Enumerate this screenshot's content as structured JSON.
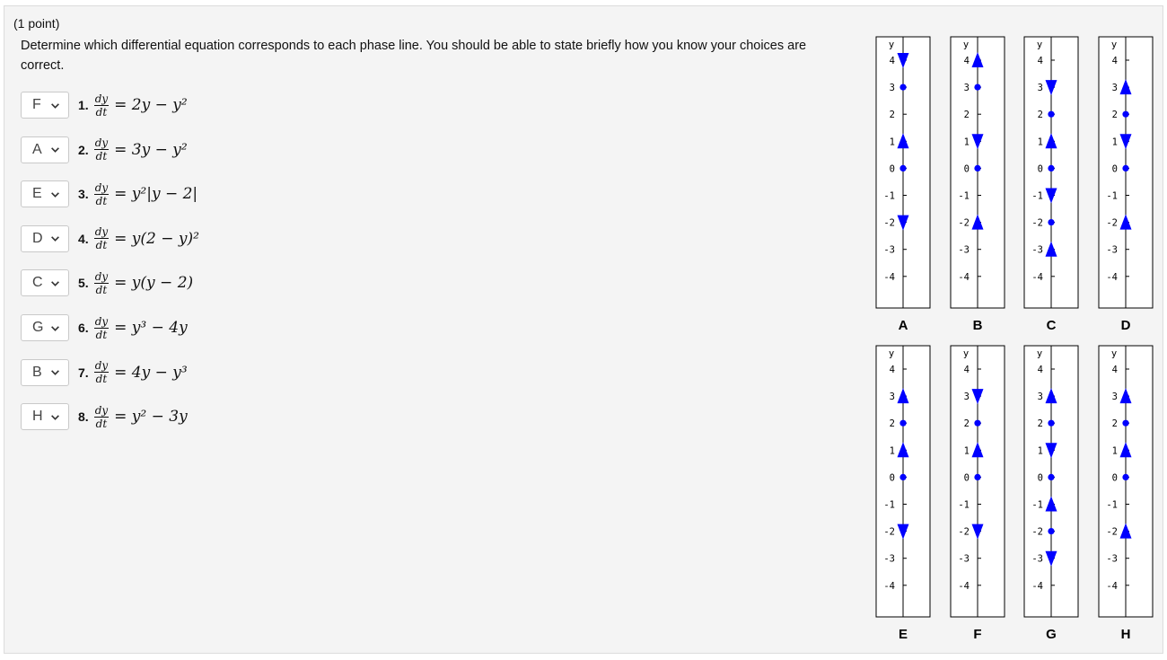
{
  "header": {
    "points": "(1 point)",
    "prompt": "Determine which differential equation corresponds to each phase line. You should be able to state briefly how you know your choices are correct."
  },
  "questions": [
    {
      "selected": "F",
      "number": "1.",
      "rhs": "= 2y − y²"
    },
    {
      "selected": "A",
      "number": "2.",
      "rhs": "= 3y − y²"
    },
    {
      "selected": "E",
      "number": "3.",
      "rhs": "= y²|y − 2|"
    },
    {
      "selected": "D",
      "number": "4.",
      "rhs": "= y(2 − y)²"
    },
    {
      "selected": "C",
      "number": "5.",
      "rhs": "= y(y − 2)"
    },
    {
      "selected": "G",
      "number": "6.",
      "rhs": "= y³ − 4y"
    },
    {
      "selected": "B",
      "number": "7.",
      "rhs": "= 4y − y³"
    },
    {
      "selected": "H",
      "number": "8.",
      "rhs": "= y² − 3y"
    }
  ],
  "derivative": {
    "numerator": "dy",
    "denominator": "dt"
  },
  "colors": {
    "accent": "#0000ff",
    "panel_bg": "#f4f4f4",
    "border": "#c9c9c9"
  },
  "phase_lines": {
    "axis_label": "y",
    "tick_labels": [
      "4",
      "3",
      "2",
      "1",
      "0",
      "-1",
      "-2",
      "-3",
      "-4"
    ],
    "items": [
      {
        "label": "A",
        "dots": [
          3,
          0
        ],
        "up": [
          1
        ],
        "down": [
          4,
          -2
        ]
      },
      {
        "label": "B",
        "dots": [
          3,
          0
        ],
        "up": [
          4,
          -2
        ],
        "down": [
          1
        ]
      },
      {
        "label": "C",
        "dots": [
          2,
          0,
          -2
        ],
        "up": [
          1,
          -3
        ],
        "down": [
          3,
          -1
        ]
      },
      {
        "label": "D",
        "dots": [
          2,
          0
        ],
        "up": [
          3,
          -2
        ],
        "down": [
          1
        ]
      },
      {
        "label": "E",
        "dots": [
          2,
          0
        ],
        "up": [
          3,
          1
        ],
        "down": [
          -2
        ]
      },
      {
        "label": "F",
        "dots": [
          2,
          0
        ],
        "up": [
          1
        ],
        "down": [
          3,
          -2
        ]
      },
      {
        "label": "G",
        "dots": [
          2,
          0,
          -2
        ],
        "up": [
          3,
          -1
        ],
        "down": [
          1,
          -3
        ]
      },
      {
        "label": "H",
        "dots": [
          2,
          0
        ],
        "up": [
          3,
          1,
          -2
        ],
        "down": []
      }
    ]
  }
}
